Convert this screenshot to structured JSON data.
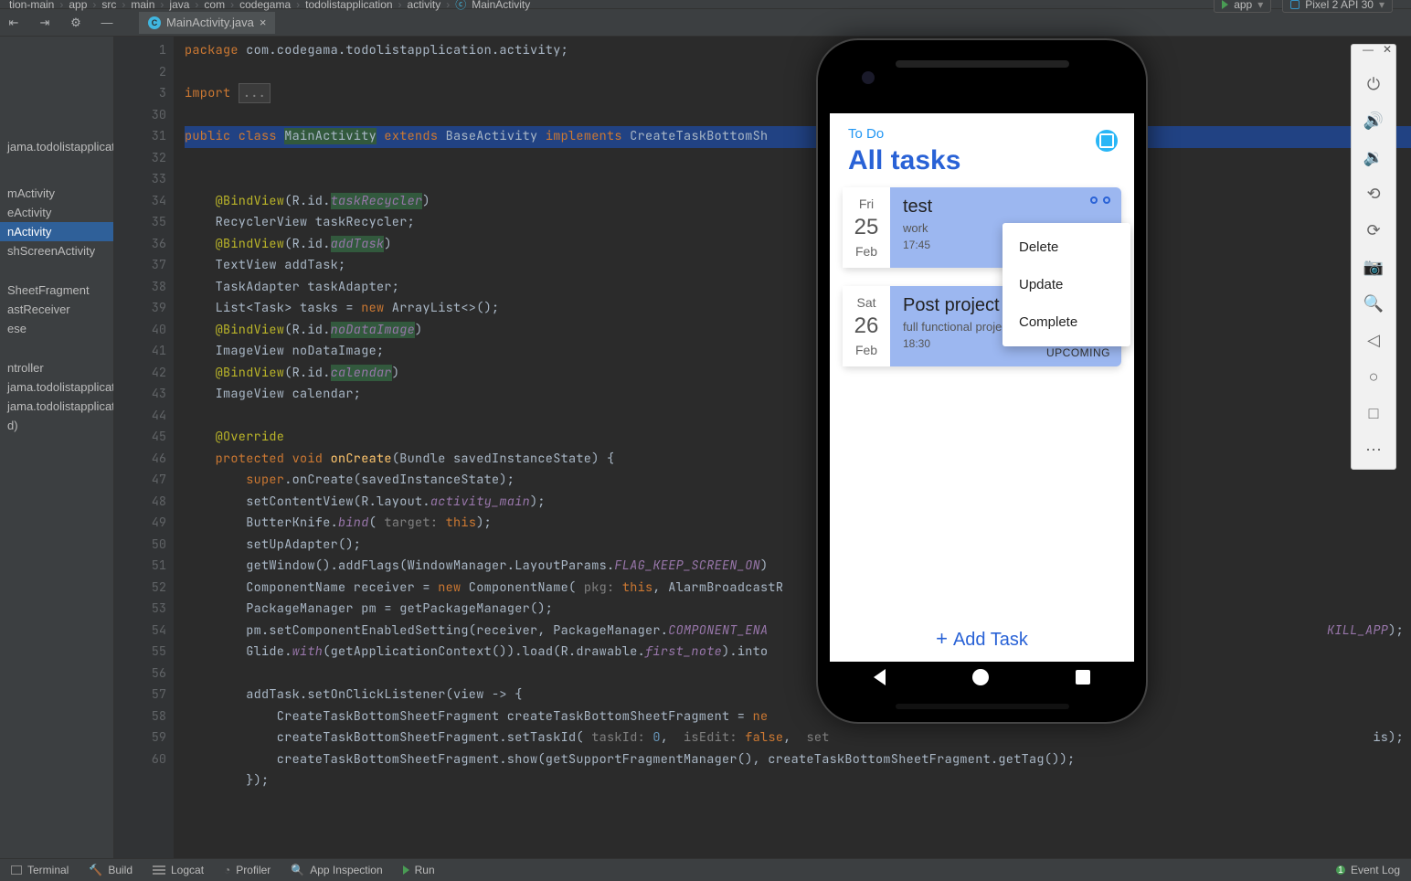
{
  "breadcrumb": [
    "tion-main",
    "app",
    "src",
    "main",
    "java",
    "com",
    "codegama",
    "todolistapplication",
    "activity",
    "MainActivity"
  ],
  "run": {
    "app": "app",
    "device": "Pixel 2 API 30"
  },
  "tab": {
    "name": "MainActivity.java"
  },
  "sidebar": {
    "items": [
      "jama.todolistapplicat",
      "mActivity",
      "eActivity",
      "nActivity",
      "shScreenActivity",
      "",
      "SheetFragment",
      "astReceiver",
      "ese",
      "",
      "ntroller",
      "jama.todolistapplicat",
      "jama.todolistapplicat",
      "d)"
    ],
    "selected": 3
  },
  "gutter": [
    "1",
    "2",
    "3",
    "30",
    "31",
    "32",
    "33",
    "34",
    "35",
    "36",
    "37",
    "38",
    "39",
    "40",
    "41",
    "42",
    "43",
    "44",
    "45",
    "46",
    "47",
    "48",
    "49",
    "50",
    "51",
    "52",
    "53",
    "54",
    "55",
    "56",
    "57",
    "58",
    "59",
    "60"
  ],
  "code": {
    "l0": "package com.codegama.todolistapplication.activity;",
    "l2": "import ",
    "l2b": "...",
    "l4": "public class MainActivity extends BaseActivity implements CreateTaskBottomSh",
    "l6a": "    @BindView",
    "l6b": "(R.id.",
    "l6c": "taskRecycler",
    "l6d": ")",
    "l7": "    RecyclerView taskRecycler;",
    "l8a": "    @BindView",
    "l8b": "(R.id.",
    "l8c": "addTask",
    "l8d": ")",
    "l9": "    TextView addTask;",
    "l10": "    TaskAdapter taskAdapter;",
    "l11a": "    List<Task> tasks = ",
    "l11b": "new",
    "l11c": " ArrayList<>();",
    "l12a": "    @BindView",
    "l12b": "(R.id.",
    "l12c": "noDataImage",
    "l12d": ")",
    "l13": "    ImageView noDataImage;",
    "l14a": "    @BindView",
    "l14b": "(R.id.",
    "l14c": "calendar",
    "l14d": ")",
    "l15": "    ImageView calendar;",
    "l17": "    @Override",
    "l18a": "    ",
    "l18b": "protected void ",
    "l18c": "onCreate",
    "l18d": "(Bundle savedInstanceState) {",
    "l19a": "        ",
    "l19b": "super",
    "l19c": ".onCreate(savedInstanceState);",
    "l20a": "        setContentView(R.layout.",
    "l20b": "activity_main",
    "l20c": ");",
    "l21a": "        ButterKnife.",
    "l21b": "bind",
    "l21c": "( ",
    "l21t": "target:",
    "l21d": " this",
    "l21e": ");",
    "l22": "        setUpAdapter();",
    "l23a": "        getWindow().addFlags(WindowManager.LayoutParams.",
    "l23b": "FLAG_KEEP_SCREEN_ON",
    "l23c": ")",
    "l24a": "        ComponentName receiver = ",
    "l24b": "new",
    "l24c": " ComponentName( ",
    "l24p": "pkg:",
    "l24d": " this",
    "l24e": ", AlarmBroadcastR",
    "l25": "        PackageManager pm = getPackageManager();",
    "l26a": "        pm.setComponentEnabledSetting(receiver, PackageManager.",
    "l26b": "COMPONENT_ENA",
    "l26t": "KILL_APP",
    "l26u": ");",
    "l27a": "        Glide.",
    "l27b": "with",
    "l27c": "(getApplicationContext()).load(R.drawable.",
    "l27d": "first_note",
    "l27e": ").into",
    "l29": "        addTask.setOnClickListener(view -> {",
    "l30a": "            CreateTaskBottomSheetFragment createTaskBottomSheetFragment = ",
    "l30b": "ne",
    "l31a": "            createTaskBottomSheetFragment.setTaskId( ",
    "l31t": "taskId:",
    "l31b": " 0",
    "l31c": ",  ",
    "l31t2": "isEdit:",
    "l31d": " false",
    "l31e": ",  ",
    "l31t3": "set",
    "l31z": "is);",
    "l32": "            createTaskBottomSheetFragment.show(getSupportFragmentManager(), createTaskBottomSheetFragment.getTag());",
    "l33": "        });"
  },
  "phone": {
    "sub": "To Do",
    "title": "All tasks",
    "addTask": "Add Task",
    "menu": [
      "Delete",
      "Update",
      "Complete"
    ],
    "card1": {
      "dow": "Fri",
      "num": "25",
      "mon": "Feb",
      "ttl": "test",
      "desc": "work",
      "time": "17:45"
    },
    "card2": {
      "dow": "Sat",
      "num": "26",
      "mon": "Feb",
      "ttl": "Post project",
      "desc": "full functional project",
      "time": "18:30",
      "status": "UPCOMING"
    }
  },
  "status": {
    "terminal": "Terminal",
    "build": "Build",
    "logcat": "Logcat",
    "profiler": "Profiler",
    "appins": "App Inspection",
    "run": "Run",
    "event": "Event Log"
  }
}
